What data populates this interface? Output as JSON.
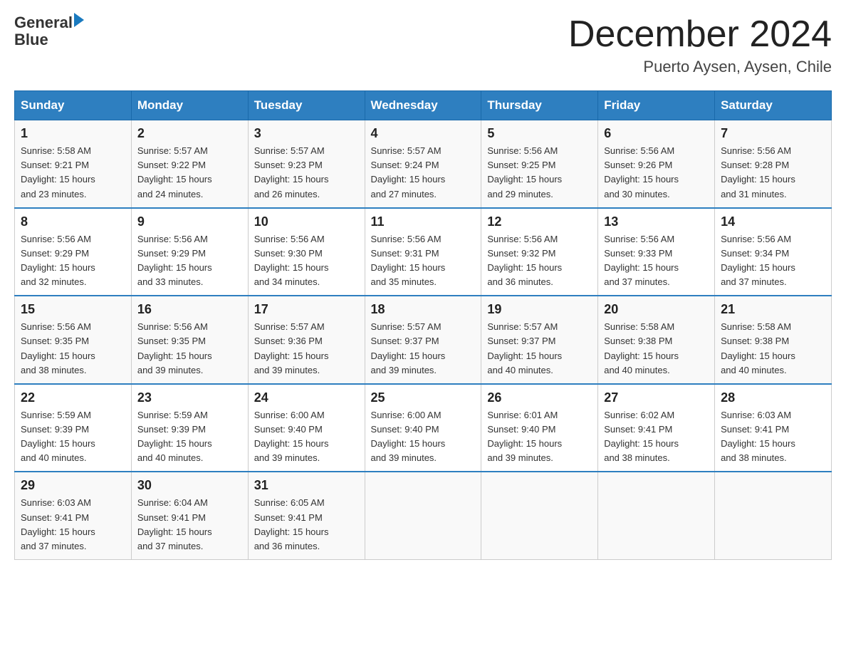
{
  "header": {
    "logo": {
      "text_general": "General",
      "text_blue": "Blue",
      "arrow": "▶"
    },
    "title": "December 2024",
    "location": "Puerto Aysen, Aysen, Chile"
  },
  "calendar": {
    "days_of_week": [
      "Sunday",
      "Monday",
      "Tuesday",
      "Wednesday",
      "Thursday",
      "Friday",
      "Saturday"
    ],
    "weeks": [
      [
        {
          "day": "1",
          "info": "Sunrise: 5:58 AM\nSunset: 9:21 PM\nDaylight: 15 hours\nand 23 minutes."
        },
        {
          "day": "2",
          "info": "Sunrise: 5:57 AM\nSunset: 9:22 PM\nDaylight: 15 hours\nand 24 minutes."
        },
        {
          "day": "3",
          "info": "Sunrise: 5:57 AM\nSunset: 9:23 PM\nDaylight: 15 hours\nand 26 minutes."
        },
        {
          "day": "4",
          "info": "Sunrise: 5:57 AM\nSunset: 9:24 PM\nDaylight: 15 hours\nand 27 minutes."
        },
        {
          "day": "5",
          "info": "Sunrise: 5:56 AM\nSunset: 9:25 PM\nDaylight: 15 hours\nand 29 minutes."
        },
        {
          "day": "6",
          "info": "Sunrise: 5:56 AM\nSunset: 9:26 PM\nDaylight: 15 hours\nand 30 minutes."
        },
        {
          "day": "7",
          "info": "Sunrise: 5:56 AM\nSunset: 9:28 PM\nDaylight: 15 hours\nand 31 minutes."
        }
      ],
      [
        {
          "day": "8",
          "info": "Sunrise: 5:56 AM\nSunset: 9:29 PM\nDaylight: 15 hours\nand 32 minutes."
        },
        {
          "day": "9",
          "info": "Sunrise: 5:56 AM\nSunset: 9:29 PM\nDaylight: 15 hours\nand 33 minutes."
        },
        {
          "day": "10",
          "info": "Sunrise: 5:56 AM\nSunset: 9:30 PM\nDaylight: 15 hours\nand 34 minutes."
        },
        {
          "day": "11",
          "info": "Sunrise: 5:56 AM\nSunset: 9:31 PM\nDaylight: 15 hours\nand 35 minutes."
        },
        {
          "day": "12",
          "info": "Sunrise: 5:56 AM\nSunset: 9:32 PM\nDaylight: 15 hours\nand 36 minutes."
        },
        {
          "day": "13",
          "info": "Sunrise: 5:56 AM\nSunset: 9:33 PM\nDaylight: 15 hours\nand 37 minutes."
        },
        {
          "day": "14",
          "info": "Sunrise: 5:56 AM\nSunset: 9:34 PM\nDaylight: 15 hours\nand 37 minutes."
        }
      ],
      [
        {
          "day": "15",
          "info": "Sunrise: 5:56 AM\nSunset: 9:35 PM\nDaylight: 15 hours\nand 38 minutes."
        },
        {
          "day": "16",
          "info": "Sunrise: 5:56 AM\nSunset: 9:35 PM\nDaylight: 15 hours\nand 39 minutes."
        },
        {
          "day": "17",
          "info": "Sunrise: 5:57 AM\nSunset: 9:36 PM\nDaylight: 15 hours\nand 39 minutes."
        },
        {
          "day": "18",
          "info": "Sunrise: 5:57 AM\nSunset: 9:37 PM\nDaylight: 15 hours\nand 39 minutes."
        },
        {
          "day": "19",
          "info": "Sunrise: 5:57 AM\nSunset: 9:37 PM\nDaylight: 15 hours\nand 40 minutes."
        },
        {
          "day": "20",
          "info": "Sunrise: 5:58 AM\nSunset: 9:38 PM\nDaylight: 15 hours\nand 40 minutes."
        },
        {
          "day": "21",
          "info": "Sunrise: 5:58 AM\nSunset: 9:38 PM\nDaylight: 15 hours\nand 40 minutes."
        }
      ],
      [
        {
          "day": "22",
          "info": "Sunrise: 5:59 AM\nSunset: 9:39 PM\nDaylight: 15 hours\nand 40 minutes."
        },
        {
          "day": "23",
          "info": "Sunrise: 5:59 AM\nSunset: 9:39 PM\nDaylight: 15 hours\nand 40 minutes."
        },
        {
          "day": "24",
          "info": "Sunrise: 6:00 AM\nSunset: 9:40 PM\nDaylight: 15 hours\nand 39 minutes."
        },
        {
          "day": "25",
          "info": "Sunrise: 6:00 AM\nSunset: 9:40 PM\nDaylight: 15 hours\nand 39 minutes."
        },
        {
          "day": "26",
          "info": "Sunrise: 6:01 AM\nSunset: 9:40 PM\nDaylight: 15 hours\nand 39 minutes."
        },
        {
          "day": "27",
          "info": "Sunrise: 6:02 AM\nSunset: 9:41 PM\nDaylight: 15 hours\nand 38 minutes."
        },
        {
          "day": "28",
          "info": "Sunrise: 6:03 AM\nSunset: 9:41 PM\nDaylight: 15 hours\nand 38 minutes."
        }
      ],
      [
        {
          "day": "29",
          "info": "Sunrise: 6:03 AM\nSunset: 9:41 PM\nDaylight: 15 hours\nand 37 minutes."
        },
        {
          "day": "30",
          "info": "Sunrise: 6:04 AM\nSunset: 9:41 PM\nDaylight: 15 hours\nand 37 minutes."
        },
        {
          "day": "31",
          "info": "Sunrise: 6:05 AM\nSunset: 9:41 PM\nDaylight: 15 hours\nand 36 minutes."
        },
        {
          "day": "",
          "info": ""
        },
        {
          "day": "",
          "info": ""
        },
        {
          "day": "",
          "info": ""
        },
        {
          "day": "",
          "info": ""
        }
      ]
    ]
  }
}
